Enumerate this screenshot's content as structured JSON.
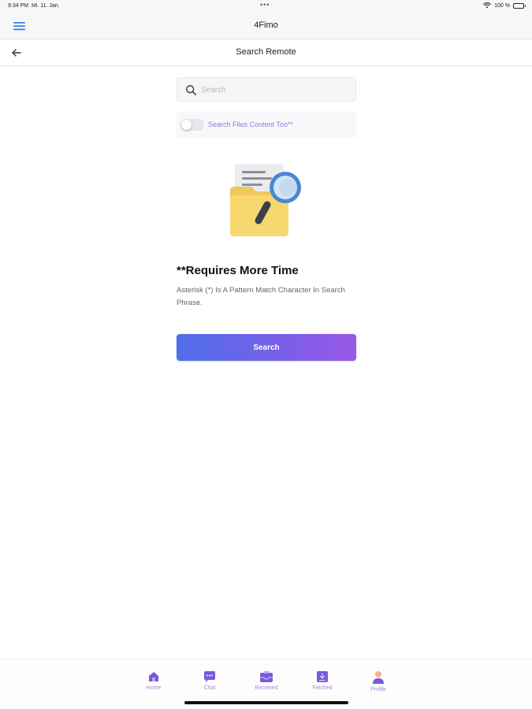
{
  "status_bar": {
    "time": "9:34 PM",
    "date": "Mi. 11. Jan.",
    "dots": "•••",
    "battery": "100 %"
  },
  "app_bar": {
    "title": "4Fimo",
    "menu_icon": "hamburger-menu-icon"
  },
  "nav_bar": {
    "title": "Search Remote",
    "back_icon": "arrow-left-icon"
  },
  "search": {
    "placeholder": "Search",
    "value": ""
  },
  "content_toggle": {
    "label": "Search Files Content Too**",
    "on": false
  },
  "info": {
    "heading": "**Requires More Time",
    "description": "Asterisk (*) Is A Pattern Match Character In Search Phrase."
  },
  "search_button": {
    "label": "Search"
  },
  "tabs": [
    {
      "label": "Home",
      "icon": "home-icon"
    },
    {
      "label": "Chat",
      "icon": "chat-icon"
    },
    {
      "label": "Received",
      "icon": "inbox-icon"
    },
    {
      "label": "Fetched",
      "icon": "download-icon"
    },
    {
      "label": "Profile",
      "icon": "user-icon"
    }
  ],
  "colors": {
    "accent": "#7b5ee8",
    "gradient_start": "#4f6fe8",
    "gradient_end": "#9a58e6",
    "tab_label": "#9a8ae0",
    "menu_icon": "#3f7be0"
  }
}
